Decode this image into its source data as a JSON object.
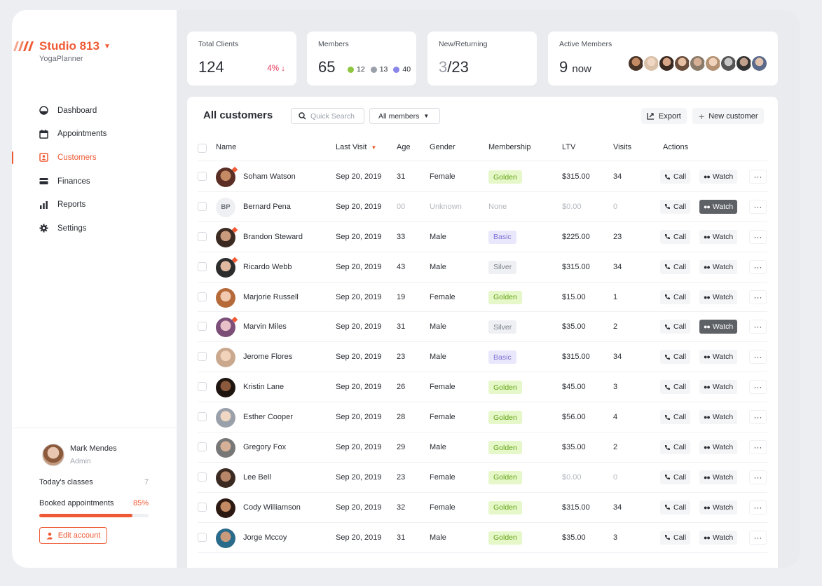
{
  "brand": {
    "name": "Studio 813",
    "subtitle": "YogaPlanner",
    "accent": "#ef5a35"
  },
  "nav": [
    {
      "label": "Dashboard",
      "icon": "dashboard-icon"
    },
    {
      "label": "Appointments",
      "icon": "calendar-icon"
    },
    {
      "label": "Customers",
      "icon": "customers-icon",
      "active": true
    },
    {
      "label": "Finances",
      "icon": "wallet-icon"
    },
    {
      "label": "Reports",
      "icon": "bar-chart-icon"
    },
    {
      "label": "Settings",
      "icon": "gear-icon"
    }
  ],
  "profile": {
    "name": "Mark Mendes",
    "role": "Admin",
    "todays_classes_label": "Today's classes",
    "todays_classes_value": "7",
    "booked_label": "Booked appointments",
    "booked_value": "85%",
    "booked_fraction": 0.85,
    "edit_label": "Edit account"
  },
  "stats": {
    "total_clients": {
      "label": "Total Clients",
      "value": "124",
      "change": "4%"
    },
    "members": {
      "label": "Members",
      "value": "65",
      "green": "12",
      "gray": "13",
      "purple": "40"
    },
    "new_returning": {
      "label": "New/Returning",
      "new": "3",
      "returning": "/23"
    },
    "active": {
      "label": "Active Members",
      "value": "9",
      "suffix": "now"
    }
  },
  "main": {
    "title": "All customers",
    "search_placeholder": "Quick Search",
    "filter_label": "All members",
    "export_label": "Export",
    "new_customer_label": "New customer"
  },
  "columns": [
    "Name",
    "Last Visit",
    "Age",
    "Gender",
    "Membership",
    "LTV",
    "Visits",
    "Actions"
  ],
  "actions": {
    "call": "Call",
    "watch": "Watch",
    "more": "···"
  },
  "customers": [
    {
      "name": "Soham Watson",
      "last_visit": "Sep 20, 2019",
      "age": "31",
      "gender": "Female",
      "membership": "Golden",
      "ltv": "$315.00",
      "visits": "34",
      "dot": true,
      "watch_active": false
    },
    {
      "name": "Bernard Pena",
      "initials": "BP",
      "last_visit": "Sep 20, 2019",
      "age": "00",
      "gender": "Unknown",
      "membership": "None",
      "ltv": "$0.00",
      "visits": "0",
      "dot": false,
      "watch_active": true,
      "muted": true
    },
    {
      "name": "Brandon Steward",
      "last_visit": "Sep 20, 2019",
      "age": "33",
      "gender": "Male",
      "membership": "Basic",
      "ltv": "$225.00",
      "visits": "23",
      "dot": true,
      "watch_active": false
    },
    {
      "name": "Ricardo Webb",
      "last_visit": "Sep 20, 2019",
      "age": "43",
      "gender": "Male",
      "membership": "Silver",
      "ltv": "$315.00",
      "visits": "34",
      "dot": true,
      "watch_active": false
    },
    {
      "name": "Marjorie Russell",
      "last_visit": "Sep 20, 2019",
      "age": "19",
      "gender": "Female",
      "membership": "Golden",
      "ltv": "$15.00",
      "visits": "1",
      "dot": false,
      "watch_active": false
    },
    {
      "name": "Marvin Miles",
      "last_visit": "Sep 20, 2019",
      "age": "31",
      "gender": "Male",
      "membership": "Silver",
      "ltv": "$35.00",
      "visits": "2",
      "dot": true,
      "watch_active": true
    },
    {
      "name": "Jerome Flores",
      "last_visit": "Sep 20, 2019",
      "age": "23",
      "gender": "Male",
      "membership": "Basic",
      "ltv": "$315.00",
      "visits": "34",
      "dot": false,
      "watch_active": false
    },
    {
      "name": "Kristin Lane",
      "last_visit": "Sep 20, 2019",
      "age": "26",
      "gender": "Female",
      "membership": "Golden",
      "ltv": "$45.00",
      "visits": "3",
      "dot": false,
      "watch_active": false
    },
    {
      "name": "Esther Cooper",
      "last_visit": "Sep 20, 2019",
      "age": "28",
      "gender": "Female",
      "membership": "Golden",
      "ltv": "$56.00",
      "visits": "4",
      "dot": false,
      "watch_active": false
    },
    {
      "name": "Gregory Fox",
      "last_visit": "Sep 20, 2019",
      "age": "29",
      "gender": "Male",
      "membership": "Golden",
      "ltv": "$35.00",
      "visits": "2",
      "dot": false,
      "watch_active": false
    },
    {
      "name": "Lee Bell",
      "last_visit": "Sep 20, 2019",
      "age": "23",
      "gender": "Female",
      "membership": "Golden",
      "ltv": "$0.00",
      "visits": "0",
      "dot": false,
      "watch_active": false,
      "ltv_muted": true
    },
    {
      "name": "Cody Williamson",
      "last_visit": "Sep 20, 2019",
      "age": "32",
      "gender": "Female",
      "membership": "Golden",
      "ltv": "$315.00",
      "visits": "34",
      "dot": false,
      "watch_active": false
    },
    {
      "name": "Jorge Mccoy",
      "last_visit": "Sep 20, 2019",
      "age": "31",
      "gender": "Male",
      "membership": "Golden",
      "ltv": "$35.00",
      "visits": "3",
      "dot": false,
      "watch_active": false
    }
  ]
}
